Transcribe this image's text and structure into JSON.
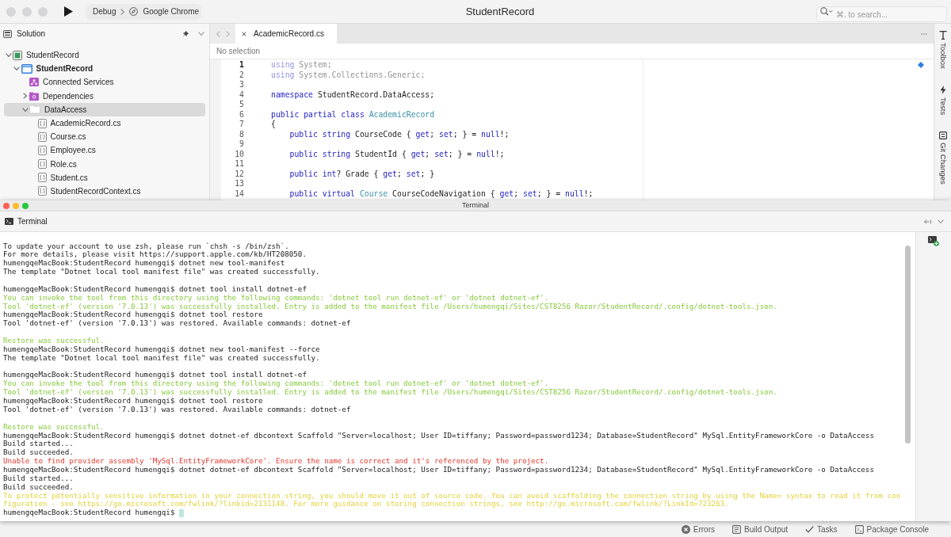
{
  "window": {
    "title": "StudentRecord",
    "active": false,
    "configuration": "Debug",
    "device": "Google Chrome",
    "search": {
      "placeholder": "⌘. to search..."
    }
  },
  "solution_panel": {
    "title": "Solution",
    "tree": [
      {
        "label": "StudentRecord",
        "kind": "solution",
        "expanded": true,
        "selected": false,
        "children": [
          {
            "label": "StudentRecord",
            "kind": "project",
            "expanded": true,
            "selected": false,
            "children": [
              {
                "label": "Connected Services",
                "kind": "services",
                "selected": false
              },
              {
                "label": "Dependencies",
                "kind": "dependencies",
                "expanded": false,
                "selected": false
              },
              {
                "label": "DataAccess",
                "kind": "folder",
                "expanded": true,
                "selected": true,
                "children": [
                  {
                    "label": "AcademicRecord.cs",
                    "kind": "file",
                    "selected": false
                  },
                  {
                    "label": "Course.cs",
                    "kind": "file",
                    "selected": false
                  },
                  {
                    "label": "Employee.cs",
                    "kind": "file",
                    "selected": false
                  },
                  {
                    "label": "Role.cs",
                    "kind": "file",
                    "selected": false
                  },
                  {
                    "label": "Student.cs",
                    "kind": "file",
                    "selected": false
                  },
                  {
                    "label": "StudentRecordContext.cs",
                    "kind": "file",
                    "selected": false
                  }
                ]
              }
            ]
          }
        ]
      }
    ]
  },
  "editor": {
    "tabs": [
      {
        "label": "AcademicRecord.cs",
        "selected": true
      }
    ],
    "breadcrumb": "No selection",
    "lines": [
      {
        "number": "1",
        "current": true,
        "faded": true,
        "tokens": [
          {
            "text": "using",
            "kind": "keyword"
          },
          {
            "text": " System;",
            "kind": "plain"
          }
        ]
      },
      {
        "number": "2",
        "current": false,
        "faded": true,
        "tokens": [
          {
            "text": "using",
            "kind": "keyword"
          },
          {
            "text": " System.Collections.Generic;",
            "kind": "plain"
          }
        ]
      },
      {
        "number": "3",
        "current": false
      },
      {
        "number": "4",
        "current": false,
        "faded": false,
        "tokens": [
          {
            "text": "namespace",
            "kind": "keyword"
          },
          {
            "text": " StudentRecord.DataAccess;",
            "kind": "plain"
          }
        ]
      },
      {
        "number": "5",
        "current": false
      },
      {
        "number": "6",
        "current": false,
        "faded": false,
        "tokens": [
          {
            "text": "public partial class ",
            "kind": "keyword"
          },
          {
            "text": "AcademicRecord",
            "kind": "type"
          }
        ]
      },
      {
        "number": "7",
        "current": false,
        "faded": false,
        "tokens": [
          {
            "text": "{",
            "kind": "plain"
          }
        ]
      },
      {
        "number": "8",
        "current": false,
        "faded": false,
        "tokens": [
          {
            "text": "    public string",
            "kind": "keyword"
          },
          {
            "text": " CourseCode { ",
            "kind": "plain"
          },
          {
            "text": "get",
            "kind": "keyword"
          },
          {
            "text": "; ",
            "kind": "plain"
          },
          {
            "text": "set",
            "kind": "keyword"
          },
          {
            "text": "; } = ",
            "kind": "plain"
          },
          {
            "text": "null",
            "kind": "keyword"
          },
          {
            "text": "!;",
            "kind": "plain"
          }
        ]
      },
      {
        "number": "9",
        "current": false
      },
      {
        "number": "10",
        "current": false,
        "faded": false,
        "tokens": [
          {
            "text": "    public string",
            "kind": "keyword"
          },
          {
            "text": " StudentId { ",
            "kind": "plain"
          },
          {
            "text": "get",
            "kind": "keyword"
          },
          {
            "text": "; ",
            "kind": "plain"
          },
          {
            "text": "set",
            "kind": "keyword"
          },
          {
            "text": "; } = ",
            "kind": "plain"
          },
          {
            "text": "null",
            "kind": "keyword"
          },
          {
            "text": "!;",
            "kind": "plain"
          }
        ]
      },
      {
        "number": "11",
        "current": false
      },
      {
        "number": "12",
        "current": false,
        "faded": false,
        "tokens": [
          {
            "text": "    public int",
            "kind": "keyword"
          },
          {
            "text": "? Grade { ",
            "kind": "plain"
          },
          {
            "text": "get",
            "kind": "keyword"
          },
          {
            "text": "; ",
            "kind": "plain"
          },
          {
            "text": "set",
            "kind": "keyword"
          },
          {
            "text": "; }",
            "kind": "plain"
          }
        ]
      },
      {
        "number": "13",
        "current": false
      },
      {
        "number": "14",
        "current": false,
        "faded": false,
        "tokens": [
          {
            "text": "    public virtual ",
            "kind": "keyword"
          },
          {
            "text": "Course",
            "kind": "type"
          },
          {
            "text": " CourseCodeNavigation { ",
            "kind": "plain"
          },
          {
            "text": "get",
            "kind": "keyword"
          },
          {
            "text": "; ",
            "kind": "plain"
          },
          {
            "text": "set",
            "kind": "keyword"
          },
          {
            "text": "; } = ",
            "kind": "plain"
          },
          {
            "text": "null",
            "kind": "keyword"
          },
          {
            "text": "!;",
            "kind": "plain"
          }
        ]
      }
    ]
  },
  "side_tabs": [
    {
      "label": "Toolbox",
      "kind": "toolbox"
    },
    {
      "label": "Tests",
      "kind": "tests"
    },
    {
      "label": "Git Changes",
      "kind": "git"
    }
  ],
  "terminal_window": {
    "title": "Terminal",
    "active": true,
    "pad_title": "Terminal",
    "blocks": [
      {
        "lines": [
          {
            "text": "To update your account to use zsh, please run `chsh -s /bin/zsh`.",
            "kind": "plain"
          },
          {
            "text": "For more details, please visit https://support.apple.com/kb/HT208050.",
            "kind": "plain"
          },
          {
            "text": "humengqeMacBook:StudentRecord humengqi$ dotnet new tool-manifest",
            "kind": "plain"
          },
          {
            "text": "The template \"Dotnet local tool manifest file\" was created successfully.",
            "kind": "plain"
          }
        ]
      },
      {
        "lines": [
          {
            "text": "humengqeMacBook:StudentRecord humengqi$ dotnet tool install dotnet-ef",
            "kind": "plain"
          },
          {
            "text": "You can invoke the tool from this directory using the following commands: 'dotnet tool run dotnet-ef' or 'dotnet dotnet-ef'.",
            "kind": "success"
          },
          {
            "text": "Tool 'dotnet-ef' (version '7.0.13') was successfully installed. Entry is added to the manifest file /Users/humengqi/Sites/CST8256 Razor/StudentRecord/.config/dotnet-tools.json.",
            "kind": "success"
          },
          {
            "text": "humengqeMacBook:StudentRecord humengqi$ dotnet tool restore",
            "kind": "plain"
          },
          {
            "text": "Tool 'dotnet-ef' (version '7.0.13') was restored. Available commands: dotnet-ef",
            "kind": "plain"
          }
        ]
      },
      {
        "lines": [
          {
            "text": "Restore was successful.",
            "kind": "success"
          },
          {
            "text": "humengqeMacBook:StudentRecord humengqi$ dotnet new tool-manifest --force",
            "kind": "plain"
          },
          {
            "text": "The template \"Dotnet local tool manifest file\" was created successfully.",
            "kind": "plain"
          }
        ]
      },
      {
        "lines": [
          {
            "text": "humengqeMacBook:StudentRecord humengqi$ dotnet tool install dotnet-ef",
            "kind": "plain"
          },
          {
            "text": "You can invoke the tool from this directory using the following commands: 'dotnet tool run dotnet-ef' or 'dotnet dotnet-ef'.",
            "kind": "success"
          },
          {
            "text": "Tool 'dotnet-ef' (version '7.0.13') was successfully installed. Entry is added to the manifest file /Users/humengqi/Sites/CST8256 Razor/StudentRecord/.config/dotnet-tools.json.",
            "kind": "success"
          },
          {
            "text": "humengqeMacBook:StudentRecord humengqi$ dotnet tool restore",
            "kind": "plain"
          },
          {
            "text": "Tool 'dotnet-ef' (version '7.0.13') was restored. Available commands: dotnet-ef",
            "kind": "plain"
          }
        ]
      },
      {
        "lines": [
          {
            "text": "Restore was successful.",
            "kind": "success"
          },
          {
            "text": "humengqeMacBook:StudentRecord humengqi$ dotnet dotnet-ef dbcontext Scaffold \"Server=localhost; User ID=tiffany; Password=password1234; Database=StudentRecord\" MySql.EntityFrameworkCore -o DataAccess",
            "kind": "plain"
          },
          {
            "text": "Build started...",
            "kind": "plain"
          },
          {
            "text": "Build succeeded.",
            "kind": "plain"
          },
          {
            "text": "Unable to find provider assembly 'MySql.EntityFrameworkCore'. Ensure the name is correct and it's referenced by the project.",
            "kind": "error"
          },
          {
            "text": "humengqeMacBook:StudentRecord humengqi$ dotnet dotnet-ef dbcontext Scaffold \"Server=localhost; User ID=tiffany; Password=password1234; Database=StudentRecord\" MySql.EntityFrameworkCore -o DataAccess",
            "kind": "plain"
          },
          {
            "text": "Build started...",
            "kind": "plain"
          },
          {
            "text": "Build succeeded.",
            "kind": "plain"
          },
          {
            "text": "To protect potentially sensitive information in your connection string, you should move it out of source code. You can avoid scaffolding the connection string by using the Name= syntax to read it from con",
            "kind": "warning"
          },
          {
            "text": "figuration - see https://go.microsoft.com/fwlink/?linkid=2131148. For more guidance on storing connection strings, see http://go.microsoft.com/fwlink/?LinkId=723263.",
            "kind": "warning"
          },
          {
            "text": "humengqeMacBook:StudentRecord humengqi$",
            "kind": "plain"
          }
        ]
      }
    ],
    "cursor": true
  },
  "status_bar": {
    "items": [
      {
        "label": "Errors",
        "kind": "errors"
      },
      {
        "label": "Build Output",
        "kind": "output"
      },
      {
        "label": "Tasks",
        "kind": "tasks"
      },
      {
        "label": "Package Console",
        "kind": "console"
      }
    ]
  }
}
